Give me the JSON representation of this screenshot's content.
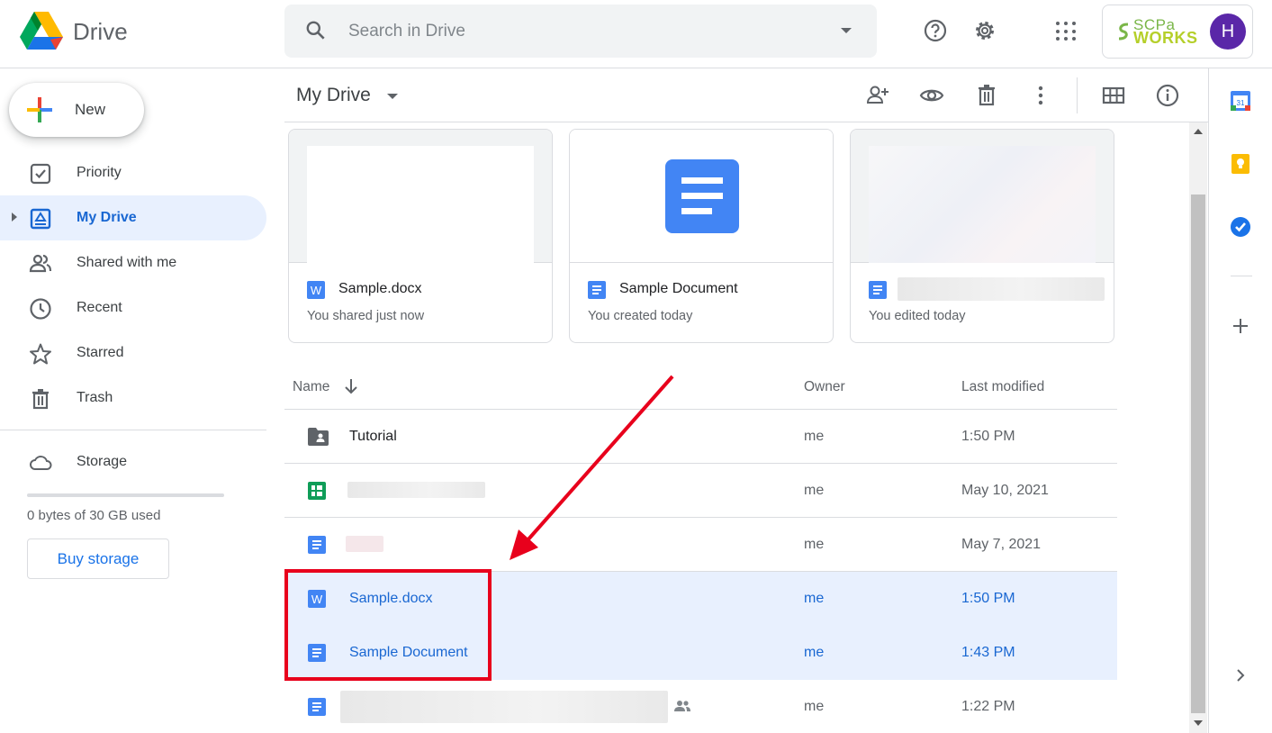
{
  "app": {
    "name": "Drive"
  },
  "search": {
    "placeholder": "Search in Drive"
  },
  "account": {
    "org_line1": "SCPa",
    "org_line2": "WORKS",
    "avatar_initial": "H"
  },
  "sidebar": {
    "new_label": "New",
    "items": [
      {
        "label": "Priority",
        "icon": "priority-icon"
      },
      {
        "label": "My Drive",
        "icon": "my-drive-icon",
        "active": true
      },
      {
        "label": "Shared with me",
        "icon": "shared-icon"
      },
      {
        "label": "Recent",
        "icon": "clock-icon"
      },
      {
        "label": "Starred",
        "icon": "star-icon"
      },
      {
        "label": "Trash",
        "icon": "trash-icon"
      }
    ],
    "storage_label": "Storage",
    "storage_used": "0 bytes of 30 GB used",
    "buy_storage": "Buy storage"
  },
  "header": {
    "title": "My Drive"
  },
  "suggested": [
    {
      "title": "Sample.docx",
      "subtitle": "You shared just now",
      "type": "word"
    },
    {
      "title": "Sample Document",
      "subtitle": "You created today",
      "type": "docs"
    },
    {
      "title": "",
      "subtitle": "You edited today",
      "type": "docs"
    }
  ],
  "list": {
    "columns": {
      "name": "Name",
      "owner": "Owner",
      "modified": "Last modified"
    },
    "rows": [
      {
        "name": "Tutorial",
        "owner": "me",
        "modified": "1:50 PM",
        "type": "shared-folder"
      },
      {
        "name": "",
        "owner": "me",
        "modified": "May 10, 2021",
        "type": "sheets"
      },
      {
        "name": "",
        "owner": "me",
        "modified": "May 7, 2021",
        "type": "docs"
      },
      {
        "name": "Sample.docx",
        "owner": "me",
        "modified": "1:50 PM",
        "type": "word",
        "selected": true
      },
      {
        "name": "Sample Document",
        "owner": "me",
        "modified": "1:43 PM",
        "type": "docs",
        "selected": true
      },
      {
        "name": "",
        "owner": "me",
        "modified": "1:22 PM",
        "type": "docs",
        "shared": true
      }
    ]
  },
  "colors": {
    "accent": "#1967d2",
    "selection": "#e8f0fe",
    "annotation": "#e8001c"
  }
}
